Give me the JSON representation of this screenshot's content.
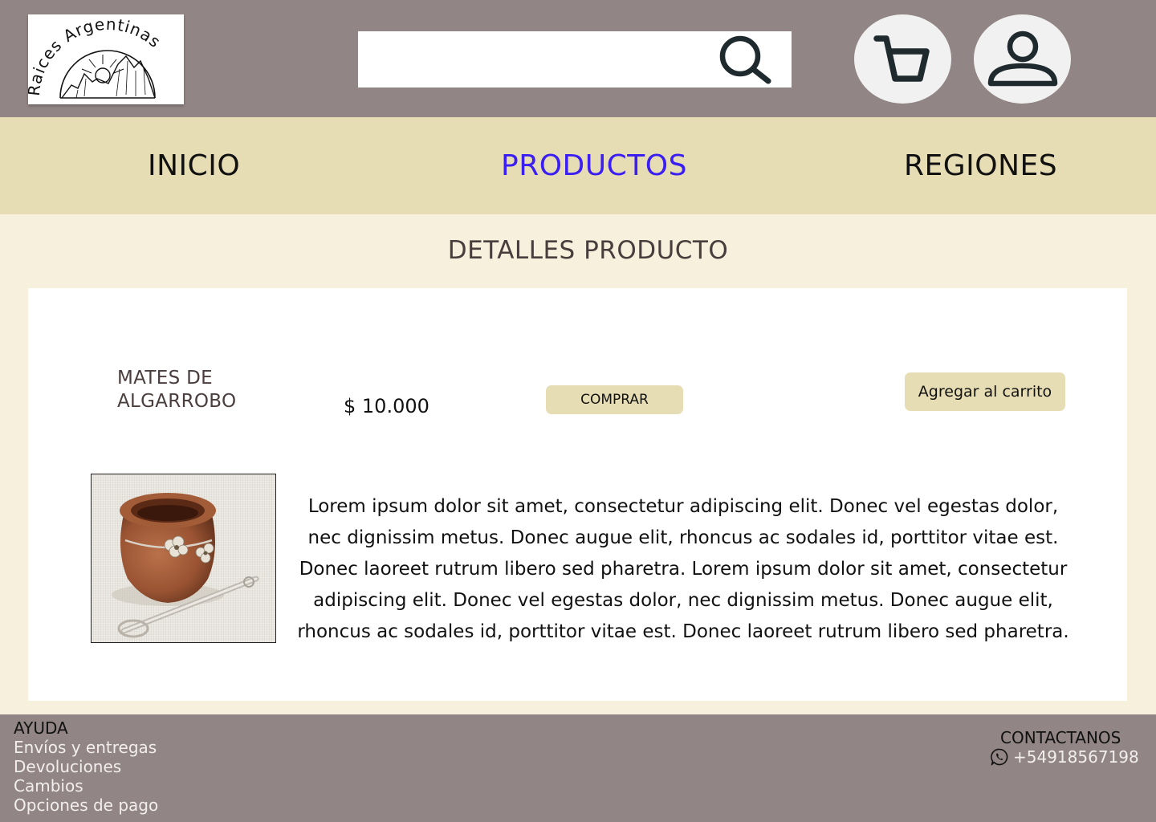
{
  "header": {
    "logo_text": "Raices Argentinas",
    "search": {
      "placeholder": "",
      "value": ""
    },
    "icons": {
      "search": "search-icon",
      "cart": "cart-icon",
      "user": "user-icon"
    }
  },
  "nav": {
    "items": [
      {
        "label": "INICIO",
        "active": false
      },
      {
        "label": "PRODUCTOS",
        "active": true
      },
      {
        "label": "REGIONES",
        "active": false
      }
    ]
  },
  "main": {
    "title": "DETALLES PRODUCTO",
    "product": {
      "name": "MATES DE ALGARROBO",
      "price": "$ 10.000",
      "buy_label": "COMPRAR",
      "add_to_cart_label": "Agregar al carrito",
      "description": "Lorem ipsum dolor sit amet, consectetur  adipiscing elit. Donec vel egestas dolor, nec  dignissim metus.  Donec augue elit, rhoncus ac sodales id, porttitor vitae est. Donec laoreet  rutrum libero sed pharetra.  Lorem ipsum dolor sit amet, consectetur adipiscing elit. Donec vel egestas dolor,  nec  dignissim metus.  Donec augue elit, rhoncus ac sodales id, porttitor vitae est.  Donec laoreet  rutrum libero sed pharetra."
    }
  },
  "footer": {
    "help": {
      "title": "AYUDA",
      "links": [
        "Envíos y entregas",
        "Devoluciones",
        "Cambios",
        "Opciones de pago"
      ]
    },
    "contact": {
      "title": "CONTACTANOS",
      "phone": "+54918567198",
      "icon": "whatsapp-icon"
    }
  },
  "colors": {
    "header_bg": "#918585",
    "nav_bg": "#e7ddb4",
    "page_bg": "#f7f0dc",
    "active_nav": "#3b1ff2",
    "button_bg": "#e7ddb4"
  }
}
